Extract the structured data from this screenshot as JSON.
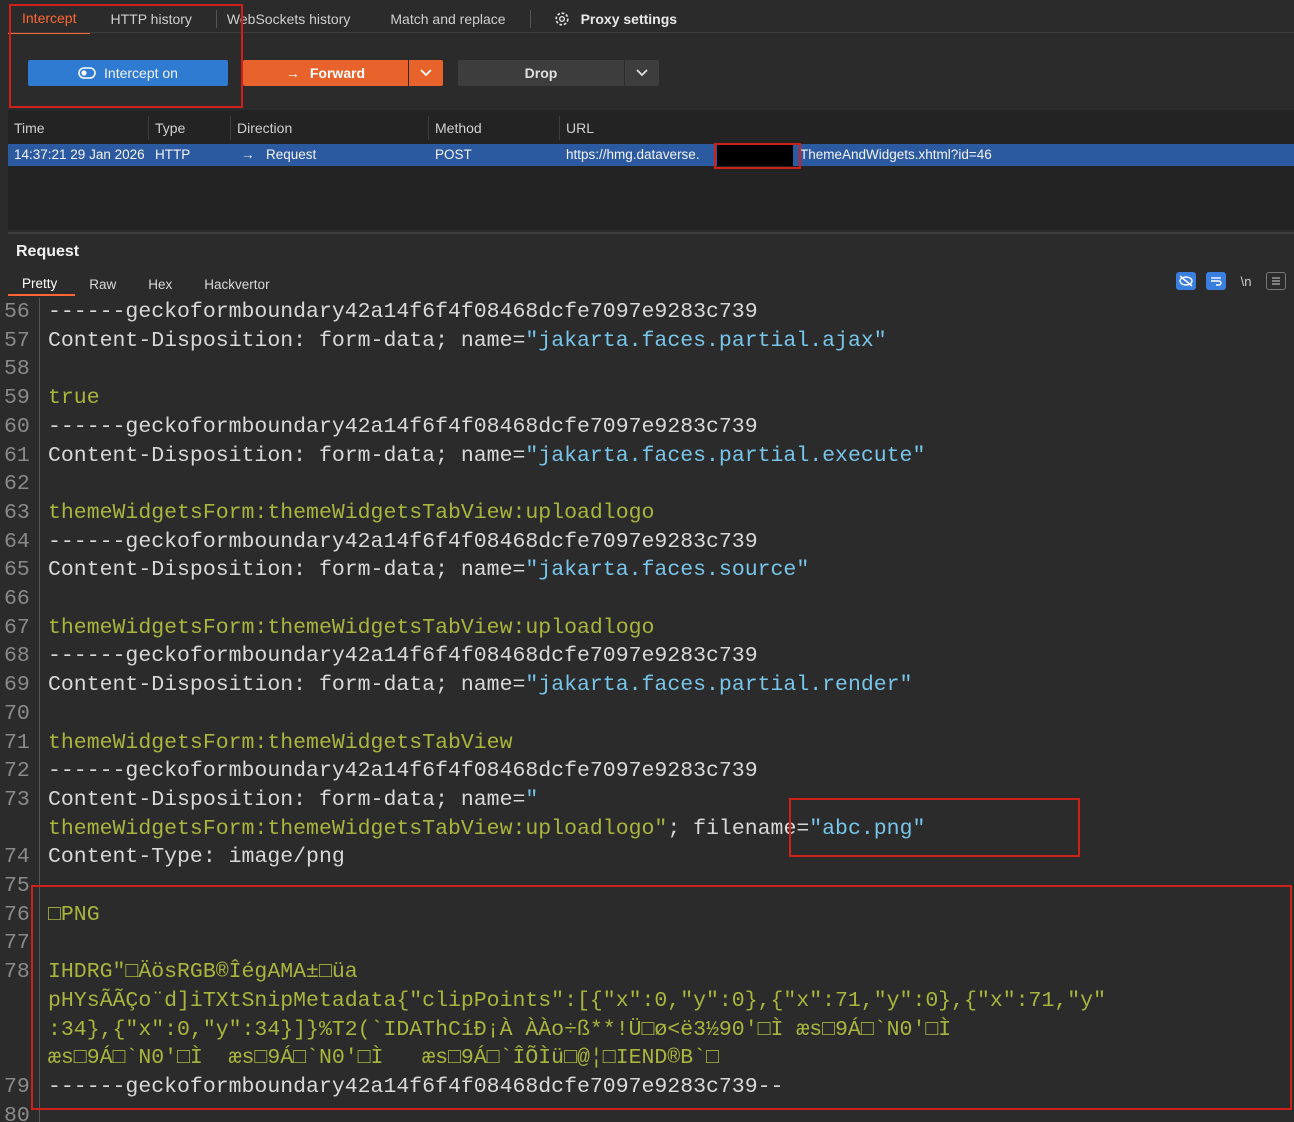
{
  "tabs": {
    "intercept": "Intercept",
    "http_history": "HTTP history",
    "websockets_history": "WebSockets history",
    "match_replace": "Match and replace",
    "proxy_settings": "Proxy settings"
  },
  "controls": {
    "intercept_label": "Intercept on",
    "forward_label": "Forward",
    "drop_label": "Drop"
  },
  "table": {
    "headers": [
      "Time",
      "Type",
      "Direction",
      "Method",
      "URL"
    ],
    "row": {
      "time": "14:37:21 29 Jan 2026",
      "type": "HTTP",
      "direction": "Request",
      "method": "POST",
      "url_prefix": "https://hmg.dataverse.",
      "url_suffix": "ThemeAndWidgets.xhtml?id=46"
    }
  },
  "request": {
    "title": "Request",
    "subtabs": [
      "Pretty",
      "Raw",
      "Hex",
      "Hackvertor"
    ],
    "newline_icon": "\\n"
  },
  "editor_lines": [
    {
      "n": "56",
      "t": "------geckoformboundary42a14f6f4f08468dcfe7097e9283c739"
    },
    {
      "n": "57",
      "k": "Content-Disposition: form-data; name=",
      "s": "\"jakarta.faces.partial.ajax\""
    },
    {
      "n": "58",
      "t": ""
    },
    {
      "n": "59",
      "g": "true"
    },
    {
      "n": "60",
      "t": "------geckoformboundary42a14f6f4f08468dcfe7097e9283c739"
    },
    {
      "n": "61",
      "k": "Content-Disposition: form-data; name=",
      "s": "\"jakarta.faces.partial.execute\""
    },
    {
      "n": "62",
      "t": ""
    },
    {
      "n": "63",
      "g": "themeWidgetsForm:themeWidgetsTabView:uploadlogo"
    },
    {
      "n": "64",
      "t": "------geckoformboundary42a14f6f4f08468dcfe7097e9283c739"
    },
    {
      "n": "65",
      "k": "Content-Disposition: form-data; name=",
      "s": "\"jakarta.faces.source\""
    },
    {
      "n": "66",
      "t": ""
    },
    {
      "n": "67",
      "g": "themeWidgetsForm:themeWidgetsTabView:uploadlogo"
    },
    {
      "n": "68",
      "t": "------geckoformboundary42a14f6f4f08468dcfe7097e9283c739"
    },
    {
      "n": "69",
      "k": "Content-Disposition: form-data; name=",
      "s": "\"jakarta.faces.partial.render\""
    },
    {
      "n": "70",
      "t": ""
    },
    {
      "n": "71",
      "g": "themeWidgetsForm:themeWidgetsTabView"
    },
    {
      "n": "72",
      "t": "------geckoformboundary42a14f6f4f08468dcfe7097e9283c739"
    },
    {
      "n": "73",
      "k": "Content-Disposition: form-data; name=",
      "s": "\""
    },
    {
      "n": "",
      "s": "themeWidgetsForm:themeWidgetsTabView:uploadlogo\"",
      "k": "; ",
      "x": "filename=",
      "y": "\"abc.png\""
    },
    {
      "n": "74",
      "k": "Content-Type: ",
      "t2": "image/png"
    },
    {
      "n": "75",
      "t": ""
    },
    {
      "n": "76",
      "b": "□PNG"
    },
    {
      "n": "77",
      "t": ""
    },
    {
      "n": "78",
      "b": "IHDRG\"□ÄösRGB®ÎégAMA±□üa"
    },
    {
      "n": "",
      "b": "pHYsÃÃÇo¨d]iTXtSnipMetadata{\"clipPoints\":[{\"x\":0,\"y\":0},{\"x\":71,\"y\":0},{\"x\":71,\"y\""
    },
    {
      "n": "",
      "b": ":34},{\"x\":0,\"y\":34}]}%T2(`IDAThCíÐ¡À ÀÀo÷ß**!Ü□ø<ë3½90'□Ì æs□9Á□`N0'□Ì"
    },
    {
      "n": "",
      "b": "æs□9Á□`N0'□Ì  æs□9Á□`N0'□Ì   æs□9Á□`ÎÕÌü□@¦□IEND®B`□"
    },
    {
      "n": "79",
      "t": "------geckoformboundary42a14f6f4f08468dcfe7097e9283c739--"
    },
    {
      "n": "80",
      "t": ""
    }
  ]
}
